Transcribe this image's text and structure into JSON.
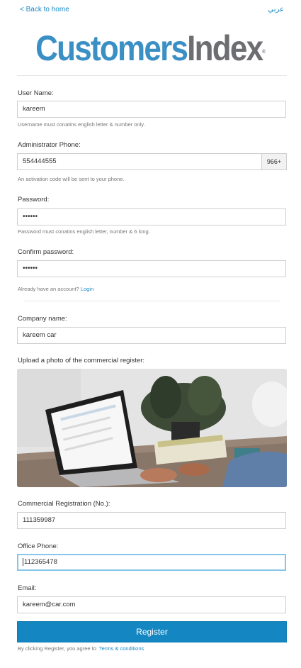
{
  "header": {
    "back_link": "< Back to home",
    "language_link": "عربي",
    "logo_part1": "Customers",
    "logo_part2": "Index",
    "logo_reg": "®"
  },
  "form": {
    "username": {
      "label": "User Name:",
      "value": "kareem",
      "hint": "Username must conatins english letter & number only."
    },
    "phone": {
      "label": "Administrator Phone:",
      "value": "554444555",
      "prefix": "966+",
      "hint": "An activation code will be sent to your phone."
    },
    "password": {
      "label": "Password:",
      "value": "••••••",
      "hint": "Password must conatins english letter, number & 6 long."
    },
    "confirm_password": {
      "label": "Confirm password:",
      "value": "••••••"
    },
    "account": {
      "text": "Already have an account?",
      "login_link": "Login"
    },
    "company_name": {
      "label": "Company name:",
      "value": "kareem car"
    },
    "photo_upload": {
      "label": "Upload a photo of the commercial register:"
    },
    "commercial_registration": {
      "label": "Commercial Registration (No.):",
      "value": "111359987"
    },
    "office_phone": {
      "label": "Office Phone:",
      "value": "112365478"
    },
    "email": {
      "label": "Email:",
      "value": "kareem@car.com"
    },
    "register_button": "Register",
    "terms": {
      "text": "By clicking Register, you agree to",
      "link": "Terms & conditions"
    }
  },
  "colors": {
    "accent": "#1487c3",
    "link": "#1a8ac6",
    "logo_blue": "#3a8fc4",
    "logo_gray": "#6d6e71"
  }
}
